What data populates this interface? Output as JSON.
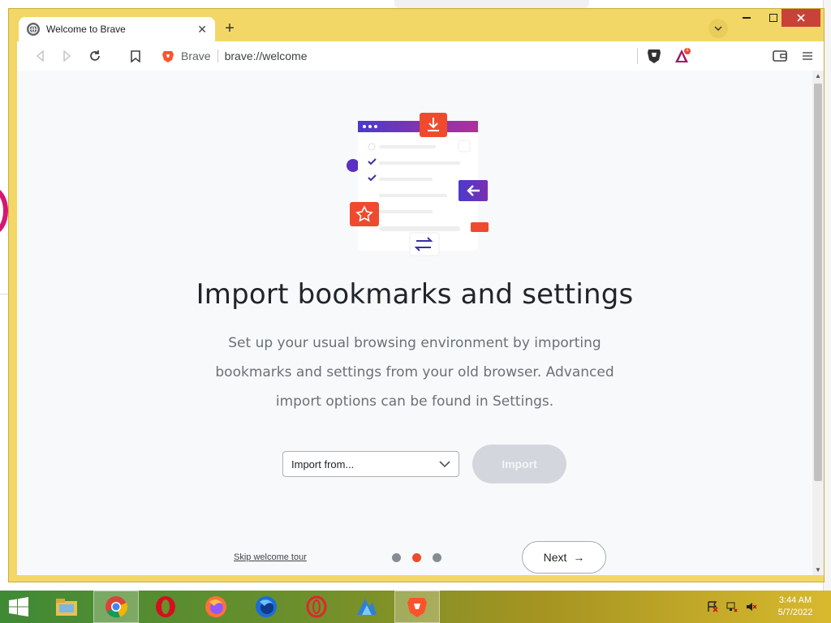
{
  "browser": {
    "tab_title": "Welcome to Brave",
    "tab_close": "✕",
    "new_tab": "+",
    "omnibox_site": "Brave",
    "omnibox_url": "brave://welcome",
    "rewards_badge": "1"
  },
  "welcome": {
    "heading": "Import bookmarks and settings",
    "description": "Set up your usual browsing environment by importing bookmarks and settings from your old browser. Advanced import options can be found in Settings.",
    "import_select_value": "Import from...",
    "import_button": "Import",
    "skip_link": "Skip welcome tour",
    "next_button": "Next",
    "next_arrow": "→",
    "steps_total": 3,
    "current_step": 2
  },
  "taskbar": {
    "time": "3:44 AM",
    "date": "5/7/2022"
  },
  "colors": {
    "window_frame": "#f2d766",
    "close_button": "#c94238",
    "accent_orange": "#f04a2e",
    "accent_purple": "#4a3bcb",
    "import_disabled": "#d4d6dd"
  },
  "icons": [
    "globe-icon",
    "back-icon",
    "forward-icon",
    "reload-icon",
    "bookmark-icon",
    "brave-lion-icon",
    "brave-shield-icon",
    "brave-rewards-icon",
    "wallet-icon",
    "menu-icon",
    "chevron-down-icon",
    "windows-start-icon"
  ]
}
